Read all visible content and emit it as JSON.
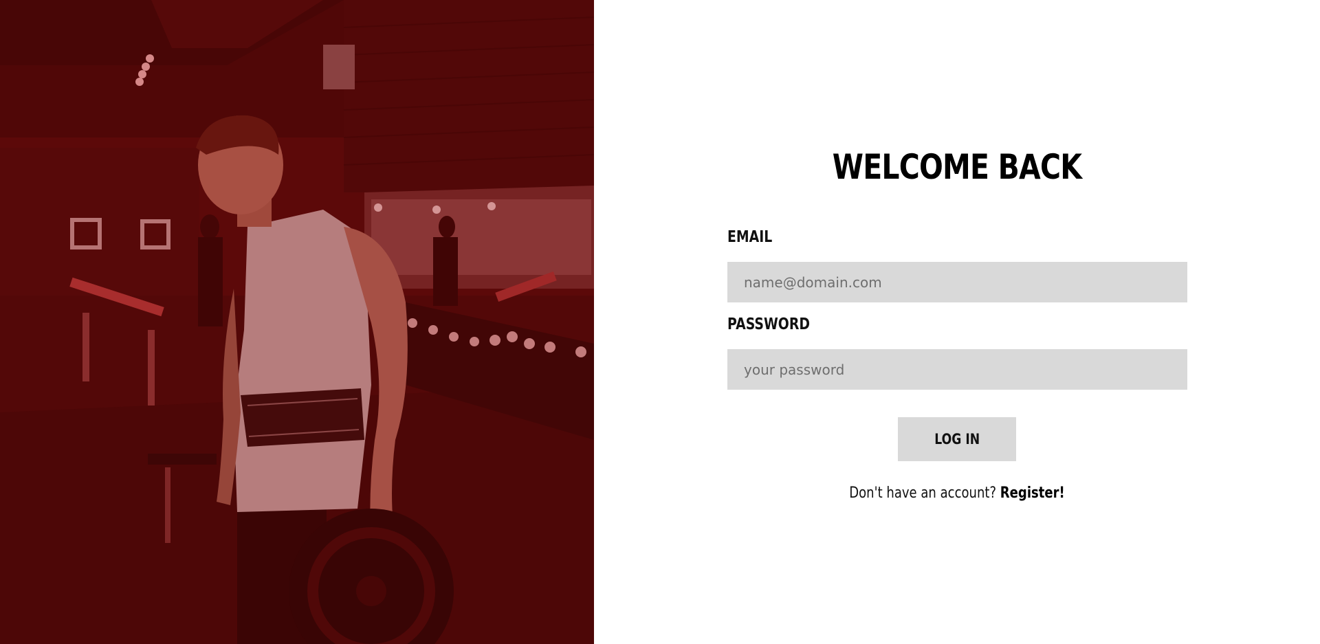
{
  "hero": {
    "overlay_color": "#8b0d0d"
  },
  "login": {
    "title": "WELCOME BACK",
    "email_label": "EMAIL",
    "email_placeholder": "name@domain.com",
    "password_label": "PASSWORD",
    "password_placeholder": "your password",
    "login_button_label": "LOG IN",
    "register_prompt": "Don't have an account?",
    "register_link_label": "Register!"
  },
  "colors": {
    "input_background": "#d9d9d9",
    "text": "#000000"
  }
}
